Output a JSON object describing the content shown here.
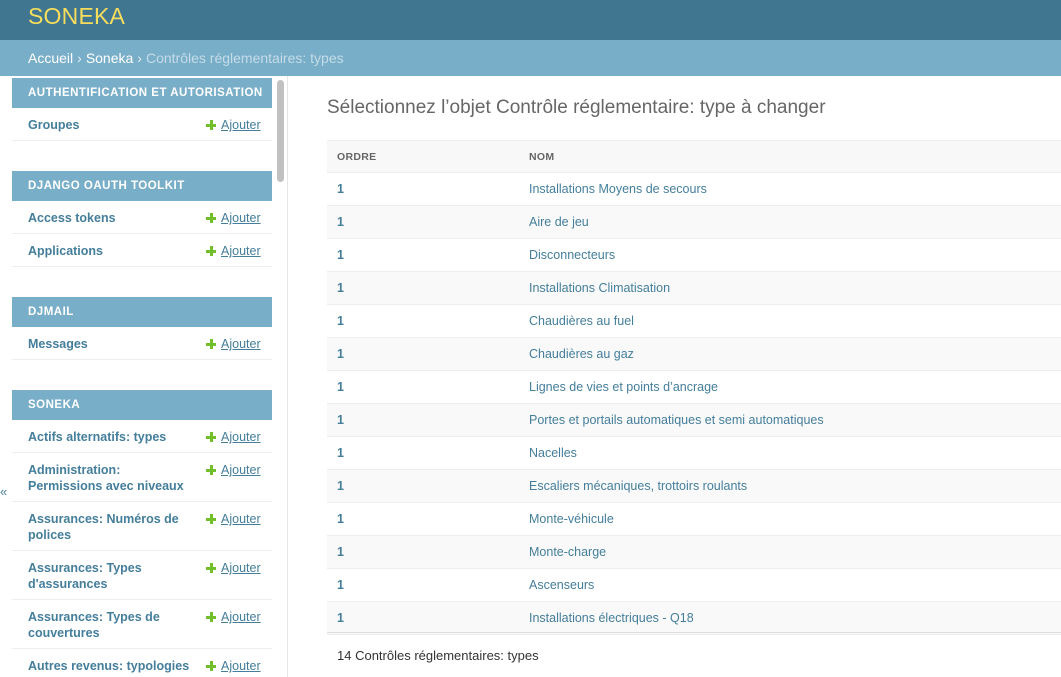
{
  "header": {
    "brand": "SONEKA"
  },
  "breadcrumbs": {
    "home": "Accueil",
    "app": "Soneka",
    "current": "Contrôles réglementaires: types",
    "separator": "›"
  },
  "sidebar": {
    "add_label": "Ajouter",
    "modules": [
      {
        "caption": "Authentification et autorisation",
        "items": [
          {
            "label": "Groupes"
          }
        ]
      },
      {
        "caption": "Django OAuth Toolkit",
        "items": [
          {
            "label": "Access tokens"
          },
          {
            "label": "Applications"
          }
        ]
      },
      {
        "caption": "Djmail",
        "items": [
          {
            "label": "Messages"
          }
        ]
      },
      {
        "caption": "Soneka",
        "items": [
          {
            "label": "Actifs alternatifs: types"
          },
          {
            "label": "Administration: Permissions avec niveaux"
          },
          {
            "label": "Assurances: Numéros de polices"
          },
          {
            "label": "Assurances: Types d'assurances"
          },
          {
            "label": "Assurances: Types de couvertures"
          },
          {
            "label": "Autres revenus: typologies"
          }
        ]
      }
    ],
    "toggle_glyph": "«"
  },
  "content": {
    "title": "Sélectionnez l’objet Contrôle réglementaire: type à changer",
    "columns": {
      "ordre": "ORDRE",
      "nom": "NOM"
    },
    "rows": [
      {
        "ordre": "1",
        "nom": "Installations Moyens de secours"
      },
      {
        "ordre": "1",
        "nom": "Aire de jeu"
      },
      {
        "ordre": "1",
        "nom": "Disconnecteurs"
      },
      {
        "ordre": "1",
        "nom": "Installations Climatisation"
      },
      {
        "ordre": "1",
        "nom": "Chaudières au fuel"
      },
      {
        "ordre": "1",
        "nom": "Chaudières au gaz"
      },
      {
        "ordre": "1",
        "nom": "Lignes de vies et points d’ancrage"
      },
      {
        "ordre": "1",
        "nom": "Portes et portails automatiques et semi automatiques"
      },
      {
        "ordre": "1",
        "nom": "Nacelles"
      },
      {
        "ordre": "1",
        "nom": "Escaliers mécaniques, trottoirs roulants"
      },
      {
        "ordre": "1",
        "nom": "Monte-véhicule"
      },
      {
        "ordre": "1",
        "nom": "Monte-charge"
      },
      {
        "ordre": "1",
        "nom": "Ascenseurs"
      },
      {
        "ordre": "1",
        "nom": "Installations électriques - Q18"
      }
    ],
    "paginator": "14 Contrôles réglementaires: types"
  },
  "colors": {
    "header": "#417690",
    "breadcrumbs": "#79aec8",
    "brand": "#f5dd5d",
    "link": "#447e9b",
    "add_icon": "#70bf2b"
  }
}
